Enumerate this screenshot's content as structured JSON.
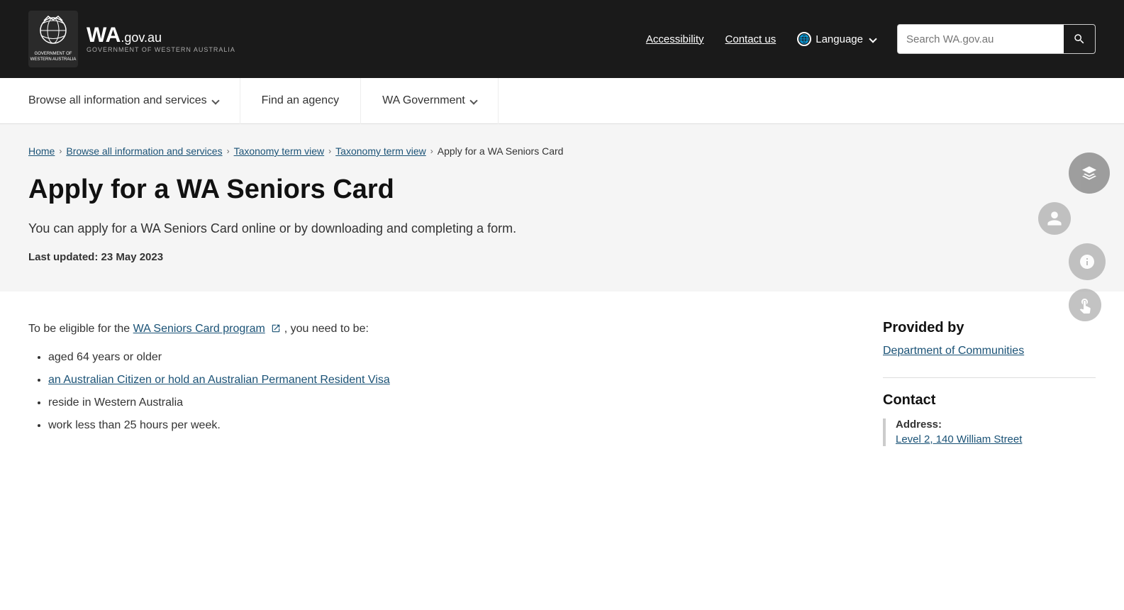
{
  "header": {
    "logo_text": "WA",
    "logo_domain": ".gov.au",
    "logo_sub": "GOVERNMENT OF WESTERN AUSTRALIA",
    "accessibility_label": "Accessibility",
    "contact_label": "Contact us",
    "language_label": "Language",
    "search_placeholder": "Search WA.gov.au"
  },
  "top_nav": {
    "items": [
      {
        "label": "Browse all information and services",
        "has_chevron": true
      },
      {
        "label": "Find an agency",
        "has_chevron": false
      },
      {
        "label": "WA Government",
        "has_chevron": true
      }
    ]
  },
  "breadcrumb": {
    "items": [
      {
        "label": "Home",
        "href": true
      },
      {
        "label": "Browse all information and services",
        "href": true
      },
      {
        "label": "Taxonomy term view",
        "href": true
      },
      {
        "label": "Taxonomy term view",
        "href": true
      },
      {
        "label": "Apply for a WA Seniors Card",
        "href": false
      }
    ]
  },
  "page": {
    "title": "Apply for a WA Seniors Card",
    "subtitle": "You can apply for a WA Seniors Card online or by downloading and completing a form.",
    "last_updated": "Last updated: 23 May 2023"
  },
  "content": {
    "eligibility_intro_start": "To be eligible for the ",
    "eligibility_link": "WA Seniors Card program",
    "eligibility_intro_end": ", you need to be:",
    "eligibility_items": [
      "aged 64 years or older",
      "an Australian Citizen or hold an Australian Permanent Resident Visa",
      "reside in Western Australia",
      "work less than 25 hours per week."
    ]
  },
  "sidebar": {
    "provided_by_title": "Provided by",
    "provider_name": "Department of Communities",
    "contact_title": "Contact",
    "address_label": "Address:",
    "address_value": "Level 2, 140 William Street"
  }
}
